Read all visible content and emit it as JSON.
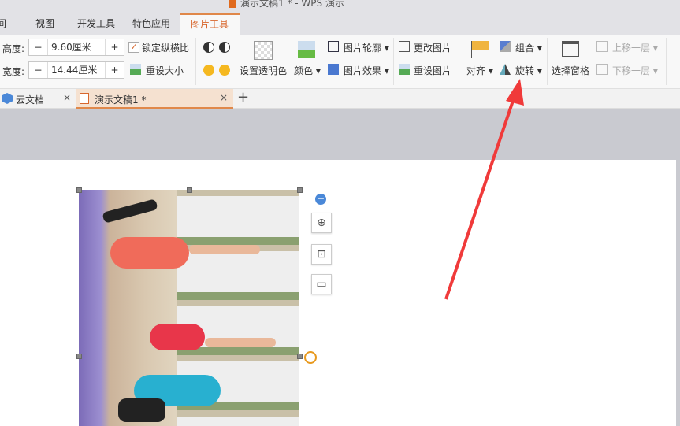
{
  "title": "演示文稿1 * - WPS 演示",
  "menu_tabs": [
    "间",
    "视图",
    "开发工具",
    "特色应用",
    "图片工具"
  ],
  "ribbon": {
    "height_label": "高度:",
    "height_value": "9.60厘米",
    "width_label": "宽度:",
    "width_value": "14.44厘米",
    "lock_ratio": "锁定纵横比",
    "lock_ratio_checked": true,
    "reset_size": "重设大小",
    "set_transparent": "设置透明色",
    "color": "颜色",
    "outline": "图片轮廓",
    "effect": "图片效果",
    "change_pic": "更改图片",
    "reset_pic": "重设图片",
    "align": "对齐",
    "group": "组合",
    "rotate": "旋转",
    "selection_pane": "选择窗格",
    "bring_forward": "上移一层",
    "send_backward": "下移一层",
    "minus": "−",
    "plus": "+"
  },
  "doc_tabs": [
    {
      "label": "云文档"
    },
    {
      "label": "演示文稿1 *",
      "active": true
    }
  ],
  "close": "×",
  "new_tab": "+",
  "colors": {
    "accent": "#d8662c",
    "arrow": "#f03a3a"
  }
}
